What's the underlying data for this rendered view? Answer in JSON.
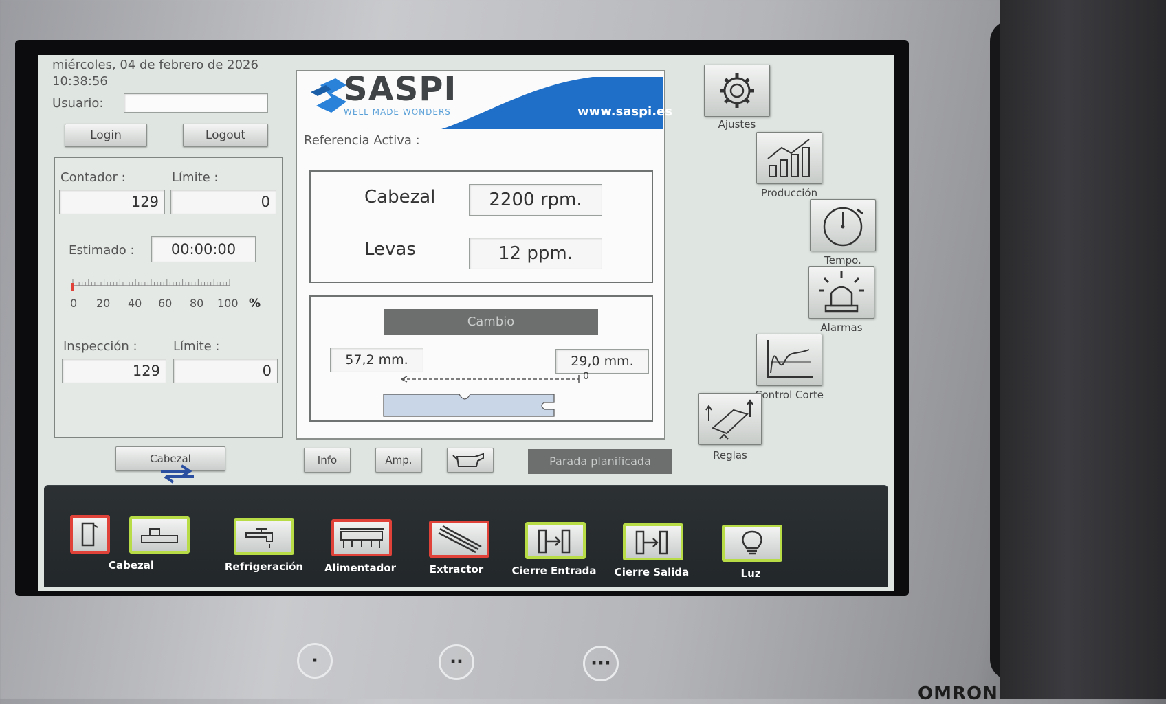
{
  "header": {
    "date": "miércoles, 04 de febrero de 2026",
    "time": "10:38:56",
    "user_label": "Usuario:",
    "user_value": "",
    "login_label": "Login",
    "logout_label": "Logout"
  },
  "counter_panel": {
    "contador_label": "Contador :",
    "contador_value": "129",
    "limite_label": "Límite :",
    "limite_value": "0",
    "estimado_label": "Estimado :",
    "estimado_value": "00:00:00",
    "scale_ticks": [
      "0",
      "20",
      "40",
      "60",
      "80",
      "100"
    ],
    "scale_unit": "%",
    "progress_percent": 0,
    "inspeccion_label": "Inspección :",
    "inspeccion_value": "129",
    "limite2_label": "Límite :",
    "limite2_value": "0"
  },
  "logo": {
    "name": "SASPI",
    "tagline": "WELL MADE WONDERS",
    "url": "www.saspi.es"
  },
  "reference": {
    "label": "Referencia Activa :",
    "value": ""
  },
  "speeds": {
    "cabezal_label": "Cabezal",
    "cabezal_value": "2200 rpm.",
    "levas_label": "Levas",
    "levas_value": "12 ppm."
  },
  "cambio": {
    "title": "Cambio",
    "left_value": "57,2 mm.",
    "right_value": "29,0 mm.",
    "zero_mark": "0"
  },
  "bottom_row": {
    "cabezal_button": "Cabezal",
    "info_button": "Info",
    "amp_button": "Amp.",
    "oil_icon": "oil-can-icon",
    "parada_button": "Parada planificada"
  },
  "right_icons": [
    {
      "label": "Ajustes",
      "icon": "gear-icon"
    },
    {
      "label": "Producción",
      "icon": "bar-chart-icon"
    },
    {
      "label": "Tempo.",
      "icon": "stopwatch-icon"
    },
    {
      "label": "Alarmas",
      "icon": "alarm-light-icon"
    },
    {
      "label": "Control Corte",
      "icon": "wave-chart-icon"
    },
    {
      "label": "Reglas",
      "icon": "rules-icon"
    }
  ],
  "bottom_bar": [
    {
      "label": "",
      "icon": "door-icon",
      "state": "red"
    },
    {
      "label": "Cabezal",
      "icon": "head-icon",
      "state": "green"
    },
    {
      "label": "Refrigeración",
      "icon": "faucet-icon",
      "state": "green"
    },
    {
      "label": "Alimentador",
      "icon": "feeder-icon",
      "state": "red"
    },
    {
      "label": "Extractor",
      "icon": "extractor-icon",
      "state": "red"
    },
    {
      "label": "Cierre Entrada",
      "icon": "clamp-in-icon",
      "state": "green"
    },
    {
      "label": "Cierre Salida",
      "icon": "clamp-out-icon",
      "state": "green"
    },
    {
      "label": "Luz",
      "icon": "light-bulb-icon",
      "state": "green"
    }
  ],
  "colors": {
    "red": "#e0423a",
    "green": "#b7dc45",
    "brand_blue": "#1f6fc8",
    "cambio_bar": "#6c6f6e"
  },
  "device": {
    "brand": "OMRON"
  }
}
